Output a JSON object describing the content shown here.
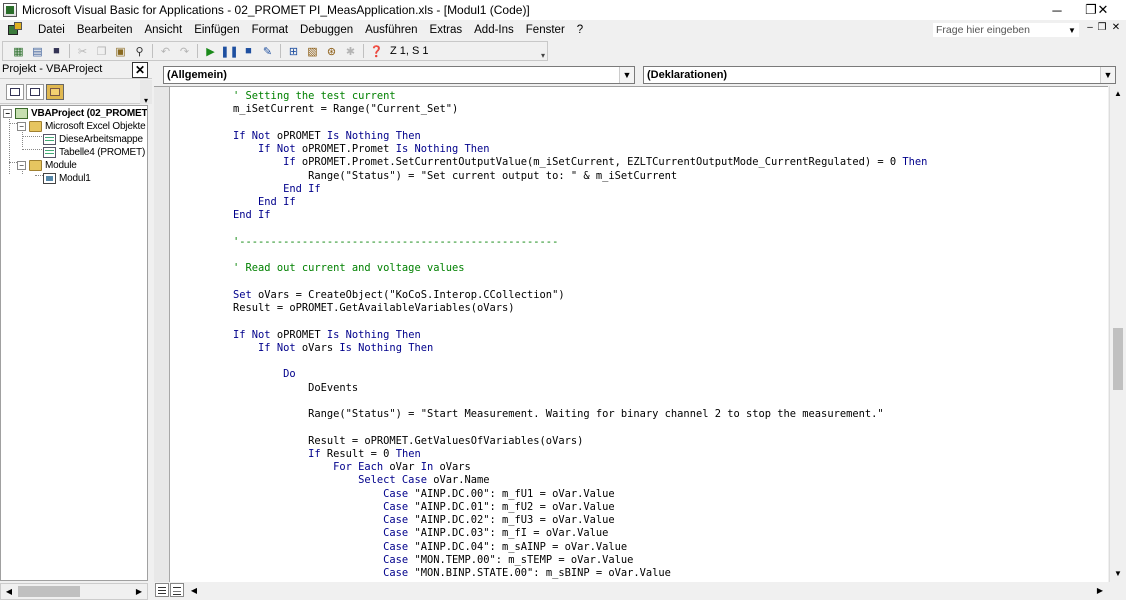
{
  "window": {
    "title": "Microsoft Visual Basic for Applications - 02_PROMET PI_MeasApplication.xls - [Modul1 (Code)]",
    "controls": [
      "─",
      "❐",
      "✕"
    ]
  },
  "menu": {
    "items": [
      "Datei",
      "Bearbeiten",
      "Ansicht",
      "Einfügen",
      "Format",
      "Debuggen",
      "Ausführen",
      "Extras",
      "Add-Ins",
      "Fenster",
      "?"
    ],
    "help_placeholder": "Frage hier eingeben",
    "mdi_controls": [
      "–",
      "❐",
      "✕"
    ]
  },
  "toolbar": {
    "position": "Z 1, S 1"
  },
  "project": {
    "title": "Projekt - VBAProject",
    "close_label": "✕",
    "tree": {
      "root": "VBAProject (02_PROMET",
      "excel_objects": "Microsoft Excel Objekte",
      "workbook": "DieseArbeitsmappe",
      "sheet": "Tabelle4 (PROMET)",
      "modules": "Module",
      "module1": "Modul1"
    }
  },
  "code": {
    "object_combo": "(Allgemein)",
    "procedure_combo": "(Deklarationen)",
    "lines": [
      [
        [
          "cm",
          "    ' Setting the test current"
        ]
      ],
      [
        [
          "",
          "    m_iSetCurrent = Range(\"Current_Set\")"
        ]
      ],
      [
        [
          "",
          ""
        ]
      ],
      [
        [
          "kw",
          "    If Not "
        ],
        [
          "",
          "oPROMET "
        ],
        [
          "kw",
          "Is Nothing Then"
        ]
      ],
      [
        [
          "kw",
          "        If Not "
        ],
        [
          "",
          "oPROMET.Promet "
        ],
        [
          "kw",
          "Is Nothing Then"
        ]
      ],
      [
        [
          "kw",
          "            If "
        ],
        [
          "",
          "oPROMET.Promet.SetCurrentOutputValue(m_iSetCurrent, EZLTCurrentOutputMode_CurrentRegulated) = 0 "
        ],
        [
          "kw",
          "Then"
        ]
      ],
      [
        [
          "",
          "                Range(\"Status\") = \"Set current output to: \" & m_iSetCurrent"
        ]
      ],
      [
        [
          "kw",
          "            End If"
        ]
      ],
      [
        [
          "kw",
          "        End If"
        ]
      ],
      [
        [
          "kw",
          "    End If"
        ]
      ],
      [
        [
          "",
          ""
        ]
      ],
      [
        [
          "cm",
          "    '---------------------------------------------------"
        ]
      ],
      [
        [
          "",
          ""
        ]
      ],
      [
        [
          "cm",
          "    ' Read out current and voltage values"
        ]
      ],
      [
        [
          "",
          ""
        ]
      ],
      [
        [
          "kw",
          "    Set "
        ],
        [
          "",
          "oVars = CreateObject(\"KoCoS.Interop.CCollection\")"
        ]
      ],
      [
        [
          "",
          "    Result = oPROMET.GetAvailableVariables(oVars)"
        ]
      ],
      [
        [
          "",
          ""
        ]
      ],
      [
        [
          "kw",
          "    If Not "
        ],
        [
          "",
          "oPROMET "
        ],
        [
          "kw",
          "Is Nothing Then"
        ]
      ],
      [
        [
          "kw",
          "        If Not "
        ],
        [
          "",
          "oVars "
        ],
        [
          "kw",
          "Is Nothing Then"
        ]
      ],
      [
        [
          "",
          ""
        ]
      ],
      [
        [
          "kw",
          "            Do"
        ]
      ],
      [
        [
          "",
          "                DoEvents"
        ]
      ],
      [
        [
          "",
          ""
        ]
      ],
      [
        [
          "",
          "                Range(\"Status\") = \"Start Measurement. Waiting for binary channel 2 to stop the measurement.\""
        ]
      ],
      [
        [
          "",
          ""
        ]
      ],
      [
        [
          "",
          "                Result = oPROMET.GetValuesOfVariables(oVars)"
        ]
      ],
      [
        [
          "kw",
          "                If "
        ],
        [
          "",
          "Result = 0 "
        ],
        [
          "kw",
          "Then"
        ]
      ],
      [
        [
          "kw",
          "                    For Each "
        ],
        [
          "",
          "oVar "
        ],
        [
          "kw",
          "In "
        ],
        [
          "",
          "oVars"
        ]
      ],
      [
        [
          "kw",
          "                        Select Case "
        ],
        [
          "",
          "oVar.Name"
        ]
      ],
      [
        [
          "kw",
          "                            Case "
        ],
        [
          "",
          "\"AINP.DC.00\": m_fU1 = oVar.Value"
        ]
      ],
      [
        [
          "kw",
          "                            Case "
        ],
        [
          "",
          "\"AINP.DC.01\": m_fU2 = oVar.Value"
        ]
      ],
      [
        [
          "kw",
          "                            Case "
        ],
        [
          "",
          "\"AINP.DC.02\": m_fU3 = oVar.Value"
        ]
      ],
      [
        [
          "kw",
          "                            Case "
        ],
        [
          "",
          "\"AINP.DC.03\": m_fI = oVar.Value"
        ]
      ],
      [
        [
          "kw",
          "                            Case "
        ],
        [
          "",
          "\"AINP.DC.04\": m_sAINP = oVar.Value"
        ]
      ],
      [
        [
          "kw",
          "                            Case "
        ],
        [
          "",
          "\"MON.TEMP.00\": m_sTEMP = oVar.Value"
        ]
      ],
      [
        [
          "kw",
          "                            Case "
        ],
        [
          "",
          "\"MON.BINP.STATE.00\": m_sBINP = oVar.Value"
        ]
      ]
    ]
  }
}
